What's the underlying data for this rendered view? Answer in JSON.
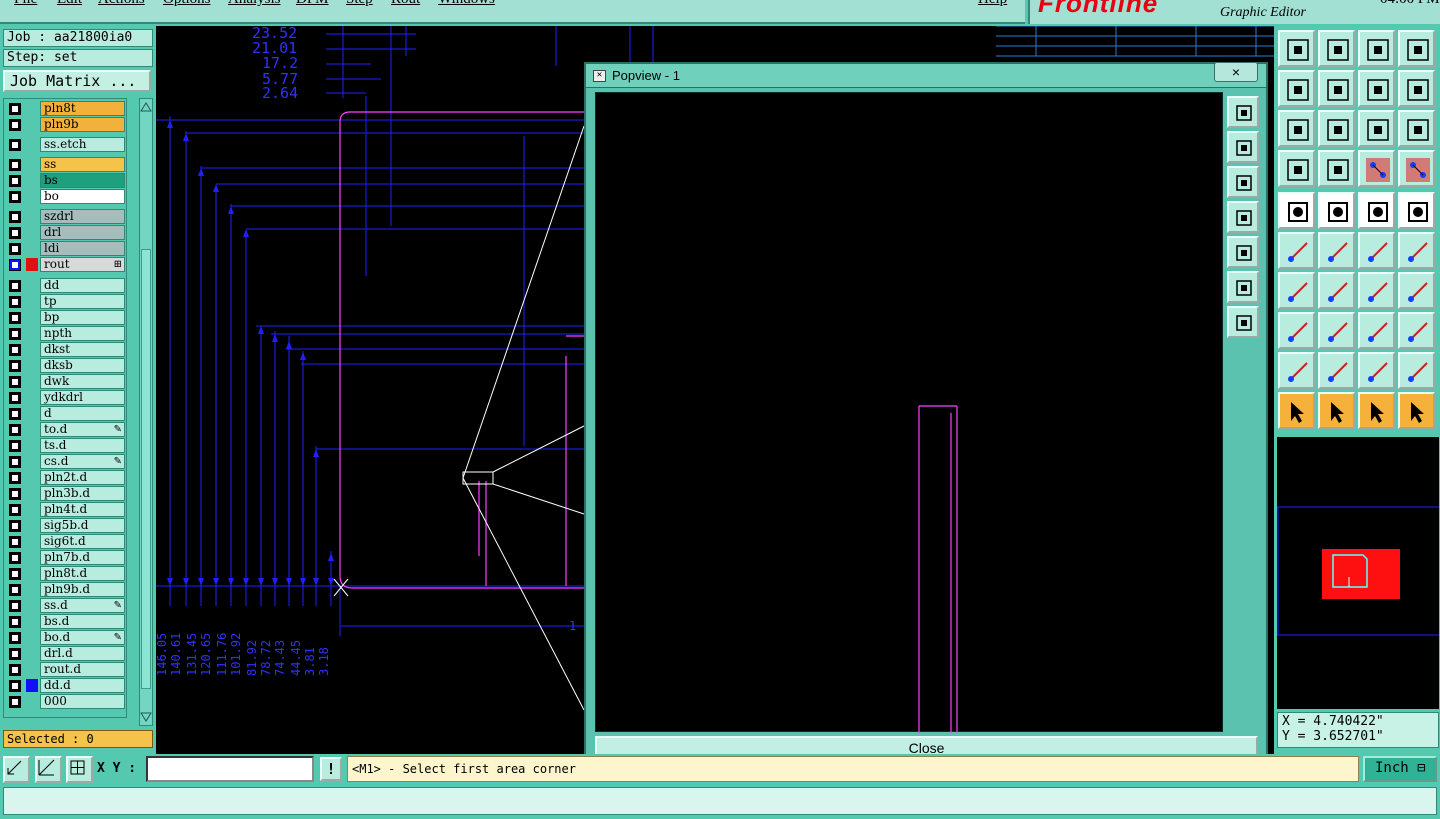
{
  "menu": [
    "File",
    "Edit",
    "Actions",
    "Options",
    "Analysis",
    "DFM",
    "Step",
    "Rout",
    "Windows",
    "Help"
  ],
  "app": {
    "logo": "Frontline",
    "subtitle": "Graphic Editor",
    "clock": "04:00 PM"
  },
  "left": {
    "job": "Job : aa21800ia0",
    "step": "Step: set",
    "job_matrix": "Job Matrix ...",
    "selected": "Selected : 0",
    "layers": [
      {
        "name": "pln8t",
        "color": "#f2b13a"
      },
      {
        "name": "pln9b",
        "color": "#f2b13a"
      },
      {
        "name": "ss.etch",
        "color": "#b8ecde"
      },
      {
        "name": "ss",
        "color": "#f5c24a"
      },
      {
        "name": "bs",
        "color": "#1ea07e"
      },
      {
        "name": "bo",
        "color": "#ffffff"
      },
      {
        "name": "szdrl",
        "color": "#a9bcbc"
      },
      {
        "name": "drl",
        "color": "#a9bcbc"
      },
      {
        "name": "ldi",
        "color": "#a9bcbc"
      },
      {
        "name": "rout",
        "color": "#d8dada",
        "selected": true,
        "sym": "⊞"
      },
      {
        "name": "dd",
        "color": "#b8ecde"
      },
      {
        "name": "tp",
        "color": "#b8ecde"
      },
      {
        "name": "bp",
        "color": "#b8ecde"
      },
      {
        "name": "npth",
        "color": "#b8ecde"
      },
      {
        "name": "dkst",
        "color": "#b8ecde"
      },
      {
        "name": "dksb",
        "color": "#b8ecde"
      },
      {
        "name": "dwk",
        "color": "#b8ecde"
      },
      {
        "name": "ydkdrl",
        "color": "#b8ecde"
      },
      {
        "name": "d",
        "color": "#b8ecde"
      },
      {
        "name": "to.d",
        "color": "#b8ecde",
        "sym": "✎"
      },
      {
        "name": "ts.d",
        "color": "#b8ecde"
      },
      {
        "name": "cs.d",
        "color": "#b8ecde",
        "sym": "✎"
      },
      {
        "name": "pln2t.d",
        "color": "#b8ecde"
      },
      {
        "name": "pln3b.d",
        "color": "#b8ecde"
      },
      {
        "name": "pln4t.d",
        "color": "#b8ecde"
      },
      {
        "name": "sig5b.d",
        "color": "#b8ecde"
      },
      {
        "name": "sig6t.d",
        "color": "#b8ecde"
      },
      {
        "name": "pln7b.d",
        "color": "#b8ecde"
      },
      {
        "name": "pln8t.d",
        "color": "#b8ecde"
      },
      {
        "name": "pln9b.d",
        "color": "#b8ecde"
      },
      {
        "name": "ss.d",
        "color": "#b8ecde",
        "sym": "✎"
      },
      {
        "name": "bs.d",
        "color": "#b8ecde"
      },
      {
        "name": "bo.d",
        "color": "#b8ecde",
        "sym": "✎"
      },
      {
        "name": "drl.d",
        "color": "#b8ecde"
      },
      {
        "name": "rout.d",
        "color": "#b8ecde"
      },
      {
        "name": "dd.d",
        "color": "#b8ecde",
        "mark": "#1010ff"
      },
      {
        "name": "000",
        "color": "#b8ecde"
      }
    ]
  },
  "canvas": {
    "dims_top": [
      "23.52",
      "21.01",
      "17.2",
      "5.77",
      "2.64"
    ],
    "dims_bottom": [
      "146.05",
      "140.61",
      "131.45",
      "120.65",
      "111.76",
      "101.92",
      "81.92",
      "78.72",
      "74.43",
      "44.45",
      "3.81",
      "3.18"
    ],
    "label_one": "1"
  },
  "popup": {
    "title": "Popview - 1",
    "close_x": "×",
    "close_button": "Close"
  },
  "bottom": {
    "xy_label": "X Y :",
    "xy_value": "",
    "bang": "!",
    "prompt": "<M1> - Select first area corner",
    "unit": "Inch ⊟"
  },
  "coords": {
    "x": "X = 4.740422\"",
    "y": "Y = 3.652701\""
  },
  "colors": {
    "accent": "#55c8b0",
    "rout_outline": "#ff40ff",
    "dim_lines": "#2020ff",
    "selected_bg": "#f5c24a"
  }
}
